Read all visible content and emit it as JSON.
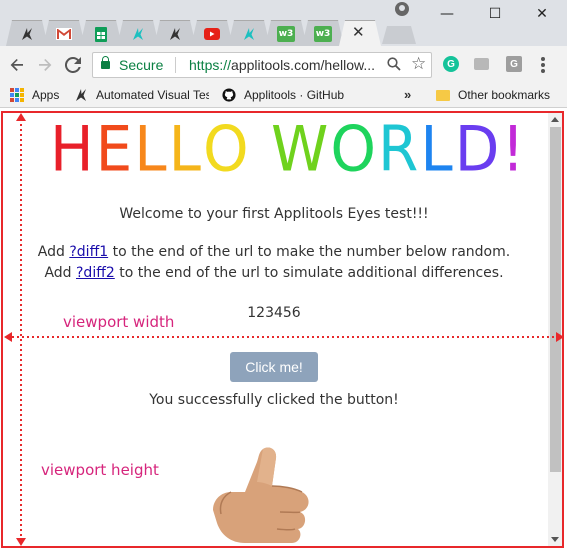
{
  "browser": {
    "tabs": [
      {
        "icon": "applitools-icon"
      },
      {
        "icon": "gmail-icon"
      },
      {
        "icon": "sheets-icon"
      },
      {
        "icon": "applitools-teal-icon"
      },
      {
        "icon": "applitools-icon"
      },
      {
        "icon": "youtube-icon"
      },
      {
        "icon": "applitools-teal-icon"
      },
      {
        "icon": "w3schools-icon",
        "text": "w3"
      },
      {
        "icon": "w3schools-icon",
        "text": "w3"
      },
      {
        "icon": "close-icon",
        "active": true,
        "close_glyph": "✕"
      }
    ],
    "window_controls": {
      "minimize": "—",
      "maximize": "☐",
      "close": "✕"
    },
    "omnibox": {
      "secure_label": "Secure",
      "url_scheme": "https://",
      "url_rest": "applitools.com/hellow..."
    },
    "extensions": [
      {
        "name": "grammarly-icon",
        "letter": "G",
        "color": "#15c39a"
      },
      {
        "name": "chat-icon",
        "letter": "",
        "color": "#b8b8b8"
      },
      {
        "name": "g-extension-icon",
        "letter": "G",
        "color": "#9e9e9e"
      }
    ],
    "bookmarks": {
      "apps": "Apps",
      "items": [
        "Automated Visual Tes",
        "Applitools · GitHub"
      ],
      "more": "»",
      "other": "Other bookmarks"
    }
  },
  "page": {
    "hello_letters": [
      {
        "ch": "H",
        "color": "#e8202a"
      },
      {
        "ch": "E",
        "color": "#f14a1b"
      },
      {
        "ch": "L",
        "color": "#f7871b"
      },
      {
        "ch": "L",
        "color": "#f5b51a"
      },
      {
        "ch": "O",
        "color": "#f2da1f"
      },
      {
        "ch": " ",
        "color": "#ffffff"
      },
      {
        "ch": "W",
        "color": "#6fd21d"
      },
      {
        "ch": "O",
        "color": "#1ed45c"
      },
      {
        "ch": "R",
        "color": "#1ec6d3"
      },
      {
        "ch": "L",
        "color": "#1e84f0"
      },
      {
        "ch": "D",
        "color": "#6a3df0"
      },
      {
        "ch": "!",
        "color": "#c22ad8"
      }
    ],
    "welcome": "Welcome to your first Applitools Eyes test!!!",
    "line1_pre": "Add ",
    "line1_link": "?diff1",
    "line1_post": " to the end of the url to make the number below random.",
    "line2_pre": "Add ",
    "line2_link": "?diff2",
    "line2_post": " to the end of the url to simulate additional differences.",
    "number": "123456",
    "button_label": "Click me!",
    "success": "You successfully clicked the button!"
  },
  "annotations": {
    "width_label": "viewport width",
    "height_label": "viewport height",
    "color": "#d6257c",
    "frame_color": "#e8282b"
  }
}
